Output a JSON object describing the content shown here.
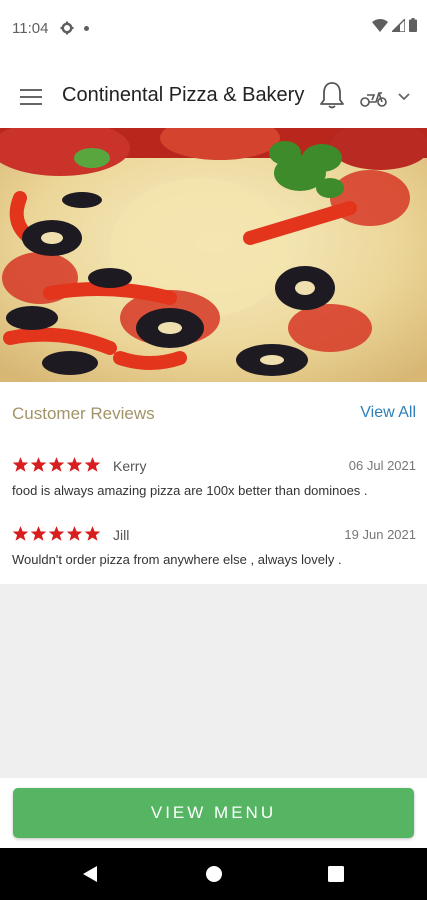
{
  "status_bar": {
    "time": "11:04"
  },
  "app_bar": {
    "title": "Continental Pizza & Bakery"
  },
  "hero": {
    "image": "pizza-photo"
  },
  "reviews": {
    "title": "Customer Reviews",
    "view_all": "View All",
    "items": [
      {
        "rating": 5,
        "name": "Kerry",
        "date": "06 Jul 2021",
        "text": "food is always amazing pizza are 100x better than dominoes ."
      },
      {
        "rating": 5,
        "name": "Jill",
        "date": "19 Jun 2021",
        "text": "Wouldn't order pizza from anywhere else , always lovely ."
      }
    ]
  },
  "footer": {
    "button_label": "VIEW MENU"
  },
  "colors": {
    "accent_green": "#55b562",
    "star_red": "#d81e1e",
    "link_blue": "#2f7fb8",
    "reviews_title": "#a29368"
  }
}
